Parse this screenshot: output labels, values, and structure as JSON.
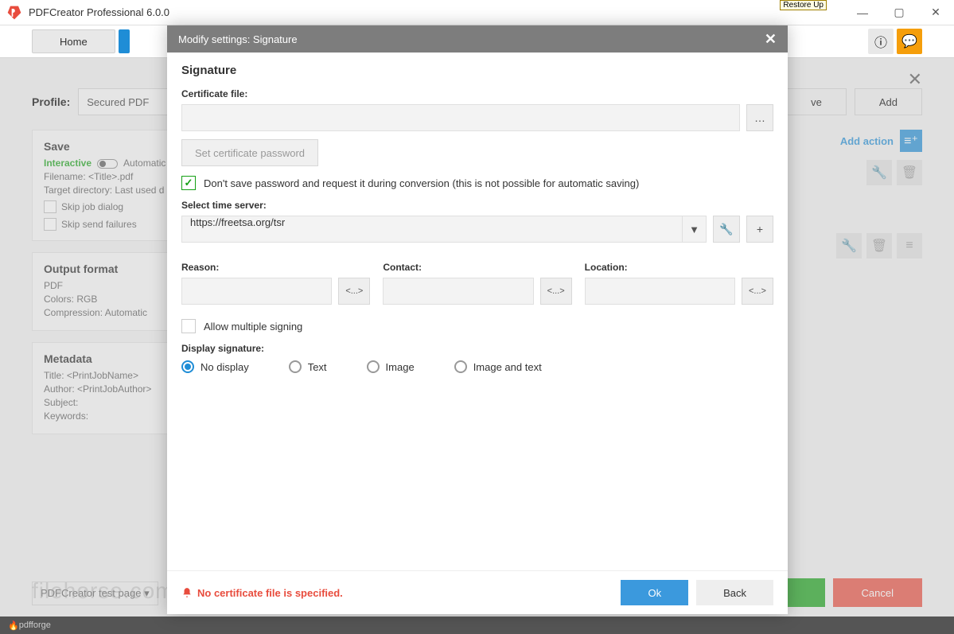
{
  "window": {
    "title": "PDFCreator Professional 6.0.0",
    "tag": "Restore Up"
  },
  "topnav": {
    "home": "Home"
  },
  "subhead": {
    "close": "✕"
  },
  "profile": {
    "label": "Profile:",
    "value": "Secured PDF",
    "remove": "ve",
    "add": "Add"
  },
  "save": {
    "title": "Save",
    "interactive": "Interactive",
    "automatic": "Automatic",
    "filename_lbl": "Filename:",
    "filename_val": "<Title>.pdf",
    "target_lbl": "Target directory:",
    "target_val": "Last used d",
    "skip_job": "Skip job dialog",
    "skip_send": "Skip send failures"
  },
  "output": {
    "title": "Output format",
    "fmt": "PDF",
    "colors_lbl": "Colors:",
    "colors_val": "RGB",
    "comp_lbl": "Compression:",
    "comp_val": "Automatic"
  },
  "metadata": {
    "title": "Metadata",
    "t_lbl": "Title:",
    "t_val": "<PrintJobName>",
    "a_lbl": "Author:",
    "a_val": "<PrintJobAuthor>",
    "s_lbl": "Subject:",
    "k_lbl": "Keywords:"
  },
  "rightcol": {
    "addaction": "Add action"
  },
  "footer": {
    "testpage": "PDFCreator test page",
    "cancel": "Cancel"
  },
  "statusbar": "pdfforge",
  "watermark": "filehorse.com",
  "modal": {
    "header": "Modify settings: Signature",
    "title": "Signature",
    "cert_label": "Certificate file:",
    "cert_value": "",
    "browse": "…",
    "set_pw": "Set certificate password",
    "dont_save": "Don't save password and request it during conversion (this is not possible for automatic saving)",
    "time_label": "Select time server:",
    "time_value": "https://freetsa.org/tsr",
    "wrench": "🔧",
    "plus": "+",
    "reason": "Reason:",
    "contact": "Contact:",
    "location": "Location:",
    "token": "<...>",
    "allow_multi": "Allow multiple signing",
    "display_label": "Display signature:",
    "radio": {
      "nodisplay": "No display",
      "text": "Text",
      "image": "Image",
      "imgtext": "Image and text"
    },
    "error": "No certificate file is specified.",
    "ok": "Ok",
    "back": "Back"
  }
}
